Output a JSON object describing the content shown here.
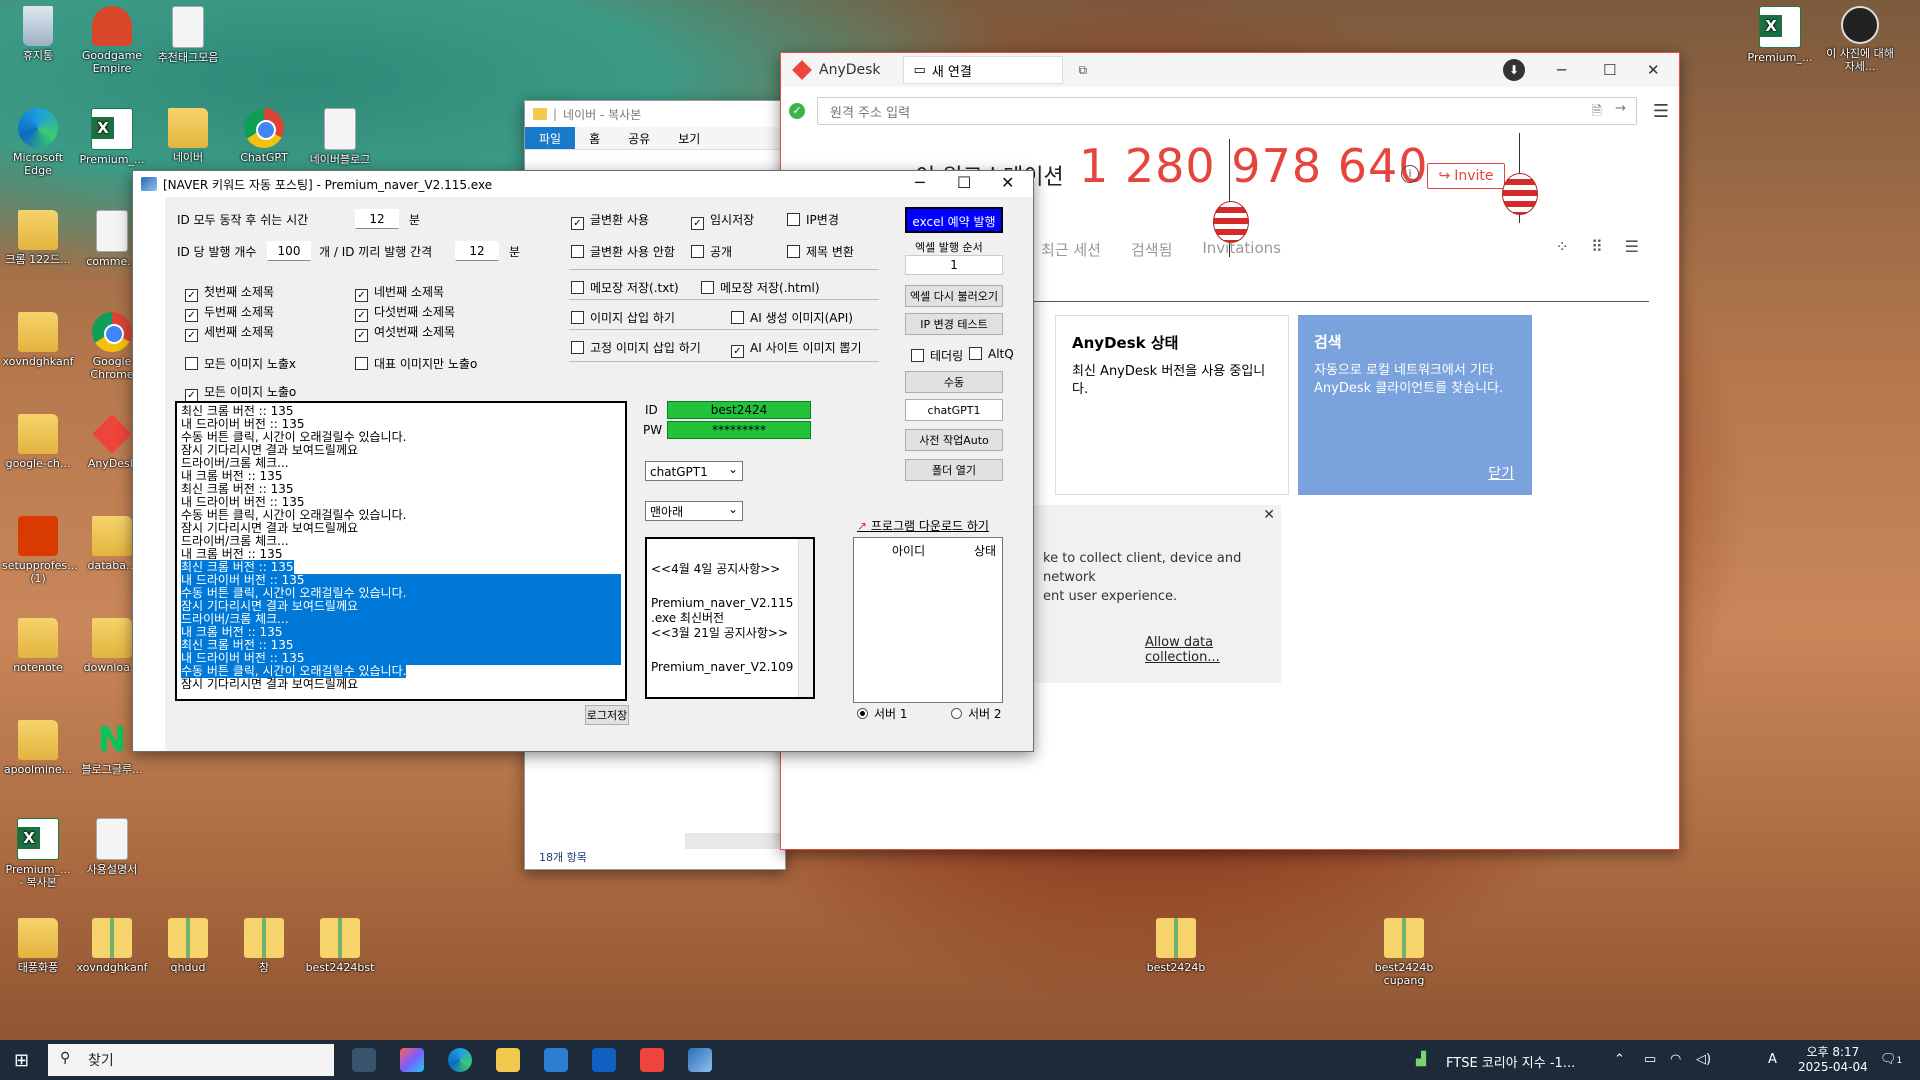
{
  "desktop_icons": [
    {
      "label": "휴지통",
      "type": "bin"
    },
    {
      "label": "Goodgame Empire",
      "type": "crown"
    },
    {
      "label": "추천태그모음",
      "type": "doc"
    },
    {
      "label": "Microsoft Edge",
      "type": "edge"
    },
    {
      "label": "Premium_...",
      "type": "xls"
    },
    {
      "label": "네이버",
      "type": "folder"
    },
    {
      "label": "ChatGPT",
      "type": "chrome"
    },
    {
      "label": "네이버블로그",
      "type": "doc"
    },
    {
      "label": "크롬 122드...",
      "type": "folder"
    },
    {
      "label": "comme...",
      "type": "doc"
    },
    {
      "label": "xovndghkanf",
      "type": "folder"
    },
    {
      "label": "Google Chrome",
      "type": "chrome"
    },
    {
      "label": "google-ch...",
      "type": "folder"
    },
    {
      "label": "AnyDesk",
      "type": "anydesk"
    },
    {
      "label": "setupprofes... (1)",
      "type": "office"
    },
    {
      "label": "databa...",
      "type": "folder"
    },
    {
      "label": "notenote",
      "type": "folder"
    },
    {
      "label": "downloa...",
      "type": "folder"
    },
    {
      "label": "apoolmine...",
      "type": "folder"
    },
    {
      "label": "블로그글루...",
      "type": "naver"
    },
    {
      "label": "Premium_... - 복사본",
      "type": "xls"
    },
    {
      "label": "사용설명서",
      "type": "doc"
    },
    {
      "label": "태풍화풍",
      "type": "folder"
    },
    {
      "label": "xovndghkanf",
      "type": "zip"
    },
    {
      "label": "qhdud",
      "type": "zip"
    },
    {
      "label": "창",
      "type": "zip"
    },
    {
      "label": "best2424bst",
      "type": "zip"
    },
    {
      "label": "best2424b",
      "type": "zip"
    },
    {
      "label": "best2424b cupang",
      "type": "zip"
    },
    {
      "label": "Premium_...",
      "type": "xls"
    },
    {
      "label": "이 사진에 대해 자세...",
      "type": "camera"
    }
  ],
  "explorer": {
    "title": "네이버 - 복사본",
    "ribbon": [
      "파일",
      "홈",
      "공유",
      "보기"
    ],
    "status": "18개 항목"
  },
  "anydesk": {
    "title": "AnyDesk",
    "tab": "새 연결",
    "address_placeholder": "원격 주소 입력",
    "workstation": "이 워크스테이션",
    "number": "1 280 978 640",
    "invite": "Invite",
    "tabs": [
      "최근 세션",
      "검색됨",
      "Invitations"
    ],
    "status_card": {
      "title": "AnyDesk 상태",
      "text": "최신 AnyDesk 버전을 사용 중입니다."
    },
    "search_card": {
      "title": "검색",
      "text": "자동으로 로컬 네트워크에서 기타 AnyDesk 클라이언트를 찾습니다.",
      "close": "닫기"
    },
    "notice": {
      "text": "...ke to collect client, device and network ...ent user experience.",
      "line1": "ke to collect client, device and network",
      "line2": "ent user experience.",
      "link": "Allow data collection..."
    }
  },
  "app": {
    "title": "[NAVER 키워드 자동 포스팅] - Premium_naver_V2.115.exe",
    "rest_label": "ID 모두 동작 후 쉬는 시간",
    "rest_value": "12",
    "rest_unit": "분",
    "per_id_label": "ID 당 발행 개수",
    "per_id_value": "100",
    "per_id_unit": "개 / ID 끼리 발행 간격",
    "interval_value": "12",
    "interval_unit": "분",
    "subtitles": [
      {
        "label": "첫번째 소제목",
        "checked": true
      },
      {
        "label": "네번째 소제목",
        "checked": true
      },
      {
        "label": "두번째 소제목",
        "checked": true
      },
      {
        "label": "다섯번째 소제목",
        "checked": true
      },
      {
        "label": "세번째 소제목",
        "checked": true
      },
      {
        "label": "여섯번째 소제목",
        "checked": true
      }
    ],
    "all_img_x": "모든 이미지 노출x",
    "rep_img_o": "대표 이미지만 노출o",
    "all_img_o": "모든 이미지 노출o",
    "opt_transform": "글변환 사용",
    "opt_tempsave": "임시저장",
    "opt_ipchange": "IP변경",
    "opt_no_transform": "글변환 사용 안함",
    "opt_public": "공개",
    "opt_title_change": "제목 변환",
    "opt_memo_txt": "메모장 저장(.txt)",
    "opt_memo_html": "메모장 저장(.html)",
    "opt_img_insert": "이미지 삽입 하기",
    "opt_ai_img_api": "AI 생성 이미지(API)",
    "opt_fixed_img": "고정 이미지 삽입 하기",
    "opt_ai_site_img": "AI 사이트 이미지 뽑기",
    "btn_excel_reserve": "excel 예약 발행",
    "excel_order_label": "엑셀 발행 순서",
    "excel_order_value": "1",
    "btn_excel_reload": "엑셀 다시 불러오기",
    "btn_ip_test": "IP 변경 테스트",
    "opt_tethering": "테더링",
    "opt_alt": "AltQ",
    "btn_manual": "수동",
    "btn_chatgpt": "chatGPT1",
    "btn_pre_auto": "사전 작업Auto",
    "btn_open_folder": "폴더 열기",
    "id_label": "ID",
    "id_value": "best2424",
    "pw_label": "PW",
    "pw_value": "*********",
    "combo_ai": "chatGPT1",
    "combo_pos": "맨아래",
    "download_link": "프로그램 다운로드 하기",
    "col_id": "아이디",
    "col_status": "상태",
    "server1": "서버 1",
    "server2": "서버 2",
    "btn_log_save": "로그저장",
    "log_lines": [
      {
        "t": "최신 크롬 버전 :: 135",
        "sel": false
      },
      {
        "t": "내 드라이버 버전 :: 135",
        "sel": false
      },
      {
        "t": "수동 버튼 클릭, 시간이 오래걸릴수 있습니다.",
        "sel": false
      },
      {
        "t": "잠시 기다리시면 결과 보여드릴께요",
        "sel": false
      },
      {
        "t": "드라이버/크롬 체크...",
        "sel": false
      },
      {
        "t": "내 크롬 버전 :: 135",
        "sel": false
      },
      {
        "t": "최신 크롬 버전 :: 135",
        "sel": false
      },
      {
        "t": "내 드라이버 버전 :: 135",
        "sel": false
      },
      {
        "t": "수동 버튼 클릭, 시간이 오래걸릴수 있습니다.",
        "sel": false
      },
      {
        "t": "잠시 기다리시면 결과 보여드릴께요",
        "sel": false
      },
      {
        "t": "드라이버/크롬 체크...",
        "sel": false
      },
      {
        "t": "내 크롬 버전 :: 135",
        "sel": false
      },
      {
        "t": "최신 크롬 버전 :: 135",
        "sel": "part"
      },
      {
        "t": "내 드라이버 버전 :: 135",
        "sel": true
      },
      {
        "t": "수동 버튼 클릭, 시간이 오래걸릴수 있습니다.",
        "sel": true
      },
      {
        "t": "잠시 기다리시면 결과 보여드릴께요",
        "sel": true
      },
      {
        "t": "드라이버/크롬 체크...",
        "sel": true
      },
      {
        "t": "내 크롬 버전 :: 135",
        "sel": true
      },
      {
        "t": "최신 크롬 버전 :: 135",
        "sel": true
      },
      {
        "t": "내 드라이버 버전 :: 135",
        "sel": true
      },
      {
        "t": "수동 버튼 클릭, 시간이 오래걸릴수 있습니다.",
        "sel": "part"
      },
      {
        "t": "잠시 기다리시면 결과 보여드릴께요",
        "sel": false
      }
    ],
    "notices": [
      "<<4월 4일 공지사항>>",
      "",
      "Premium_naver_V2.115",
      ".exe 최신버전",
      "<<3월 21일 공지사항>>",
      "",
      "Premium_naver_V2.109"
    ]
  },
  "taskbar": {
    "search_placeholder": "찾기",
    "ticker": "FTSE 코리아 지수 -1...",
    "ime": "A",
    "time": "오후 8:17",
    "date": "2025-04-04",
    "notif_count": "1"
  }
}
